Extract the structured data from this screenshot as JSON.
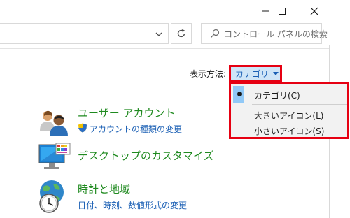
{
  "window": {
    "caption": {
      "minimize_icon": "minimize-icon",
      "maximize_icon": "maximize-icon",
      "close_icon": "close-icon"
    }
  },
  "address_bar": {
    "dropdown_icon": "chevron-down-icon",
    "refresh_icon": "refresh-icon"
  },
  "search": {
    "placeholder": "コントロール パネルの検索",
    "icon": "search-icon"
  },
  "view_by": {
    "label": "表示方法:",
    "selected": "カテゴリ",
    "menu_items": [
      {
        "label": "カテゴリ(C)",
        "selected": true
      },
      {
        "label": "大きいアイコン(L)",
        "selected": false
      },
      {
        "label": "小さいアイコン(S)",
        "selected": false
      }
    ]
  },
  "categories": [
    {
      "title": "ユーザー アカウント",
      "icon": "user-accounts-icon",
      "links": [
        {
          "label": "アカウントの種類の変更",
          "icon": "shield-icon"
        }
      ]
    },
    {
      "title": "デスクトップのカスタマイズ",
      "icon": "desktop-customization-icon",
      "links": []
    },
    {
      "title": "時計と地域",
      "icon": "clock-region-icon",
      "links": [
        {
          "label": "日付、時刻、数値形式の変更"
        }
      ]
    }
  ],
  "colors": {
    "highlight_border": "#e60012",
    "category_title": "#1f8a1f",
    "link": "#1a5fb4",
    "selected_bg": "#cfe5f7"
  }
}
